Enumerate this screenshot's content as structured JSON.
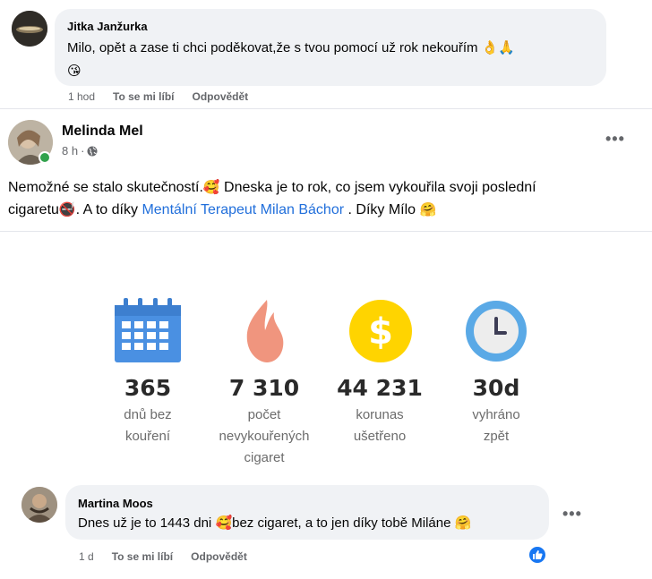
{
  "comment1": {
    "author": "Jitka Janžurka",
    "text": "Milo, opět a zase ti chci poděkovat,že s tvou pomocí už rok nekouřím",
    "emojis_inline": "👌🙏",
    "emoji_line2": "😘",
    "time": "1 hod",
    "like": "To se mi líbí",
    "reply": "Odpovědět"
  },
  "post": {
    "author": "Melinda Mel",
    "time": "8 h",
    "text_part1": "Nemožné se stalo skutečností.",
    "emoji1": "🥰",
    "text_part2": " Dneska je to rok, co jsem vykouřila svoji poslední",
    "text_part3": "cigaretu",
    "emoji2": "🚭",
    "text_part4": ". A to díky ",
    "link": "Mentální Terapeut Milan Báchor",
    "text_part5": " . Díky Mílo ",
    "emoji3": "🤗"
  },
  "stats": [
    {
      "value": "365",
      "label_lines": [
        "dnů bez",
        "kouření"
      ],
      "icon": "calendar-icon"
    },
    {
      "value": "7 310",
      "label_lines": [
        "počet",
        "nevykouřených",
        "cigaret"
      ],
      "icon": "flame-icon"
    },
    {
      "value": "44 231",
      "label_lines": [
        "korunas",
        "ušetřeno"
      ],
      "icon": "dollar-coin-icon"
    },
    {
      "value": "30d",
      "label_lines": [
        "vyhráno",
        "zpět"
      ],
      "icon": "clock-icon"
    }
  ],
  "comment2": {
    "author": "Martina Moos",
    "text": "Dnes už je to 1443 dni ",
    "emoji1": "🥰",
    "text2": "bez cigaret, a to jen díky tobě Miláne ",
    "emoji2": "🤗",
    "time": "1 d",
    "like": "To se mi líbí",
    "reply": "Odpovědět"
  },
  "colors": {
    "link": "#216fdb",
    "like_badge": "#1877f2",
    "online": "#31a24c",
    "calendar": "#4a90e2",
    "flame": "#f0957e",
    "coin": "#ffd400",
    "clock": "#5aa9e6"
  }
}
